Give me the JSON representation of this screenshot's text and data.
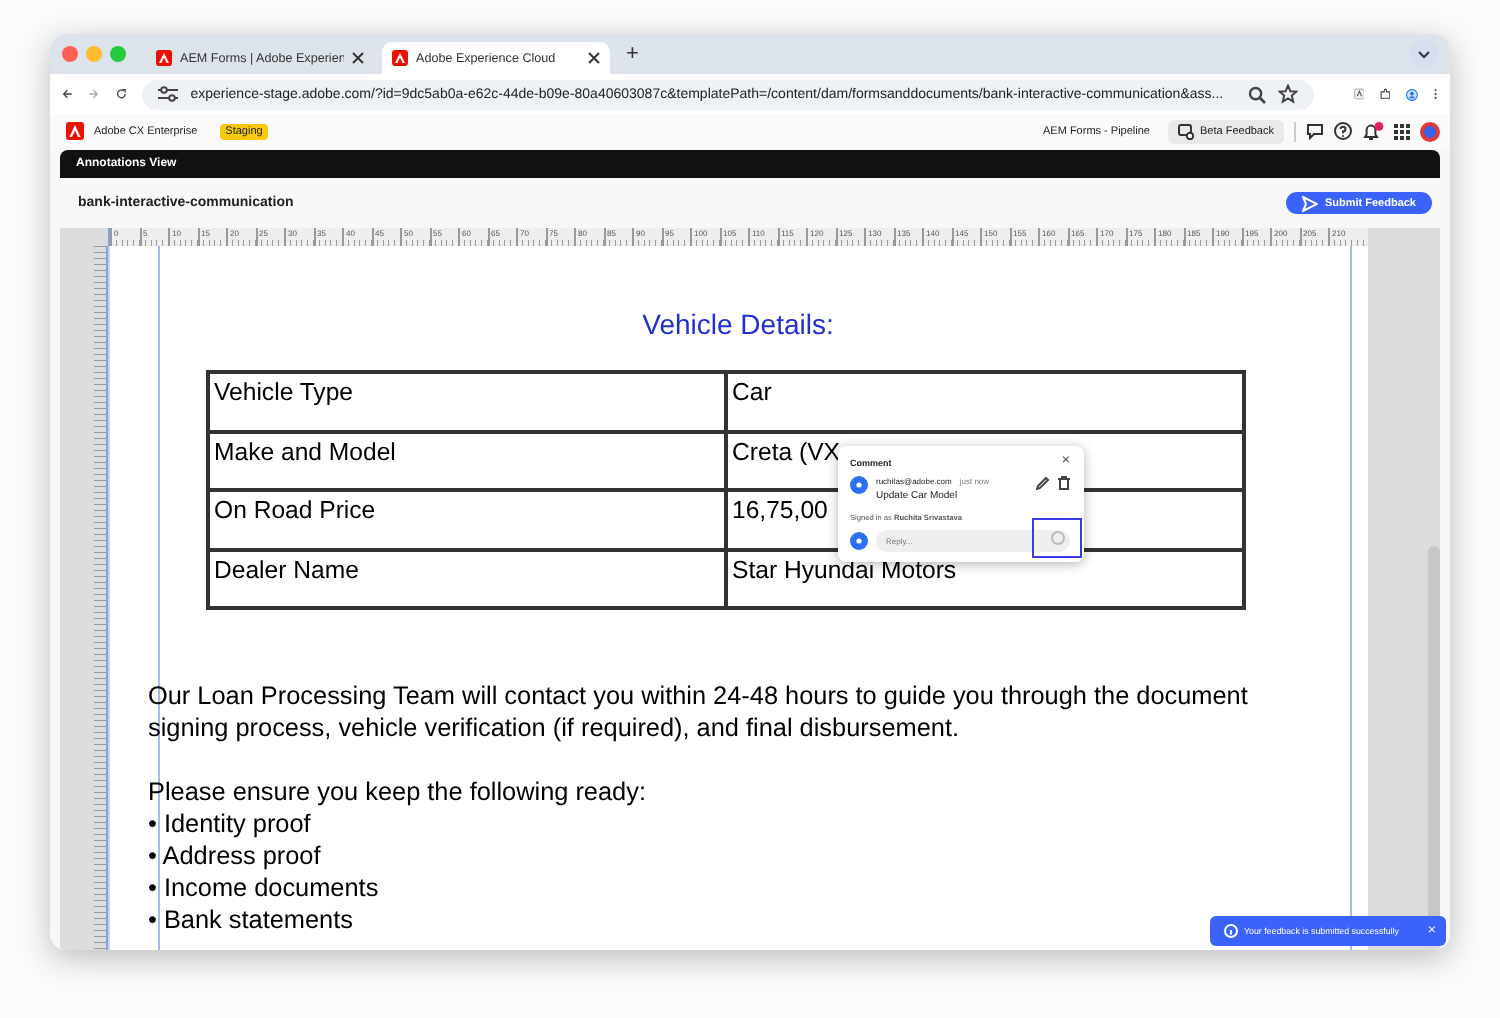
{
  "browser": {
    "tabs": [
      {
        "title": "AEM Forms | Adobe Experien",
        "selected": false
      },
      {
        "title": "Adobe Experience Cloud",
        "selected": true
      }
    ],
    "new_tab": "+",
    "address": "experience-stage.adobe.com/?id=9dc5ab0a-e62c-44de-b09e-80a40603087c&templatePath=/content/dam/formsanddocuments/bank-interactive-communication&ass..."
  },
  "app_header": {
    "brand": "Adobe CX Enterprise",
    "badge": "Staging",
    "workspace": "AEM Forms - Pipeline",
    "beta_button": "Beta Feedback"
  },
  "view_bar": {
    "title": "Annotations View"
  },
  "document_bar": {
    "title": "bank-interactive-communication",
    "submit_button": "Submit Feedback"
  },
  "ruler": {
    "labels": [
      "0",
      "5",
      "10",
      "15",
      "20",
      "25",
      "30",
      "35",
      "40",
      "45",
      "50",
      "55",
      "60",
      "65",
      "70",
      "75",
      "80",
      "85",
      "90",
      "95",
      "100",
      "105",
      "110",
      "115",
      "120",
      "125",
      "130",
      "135",
      "140",
      "145",
      "150",
      "155",
      "160",
      "165",
      "170",
      "175",
      "180",
      "185",
      "190",
      "195",
      "200",
      "205",
      "210"
    ]
  },
  "document": {
    "heading": "Vehicle Details:",
    "table": [
      [
        "Vehicle Type",
        "Car"
      ],
      [
        "Make and Model",
        "Creta (VX"
      ],
      [
        "On Road Price",
        "16,75,00"
      ],
      [
        "Dealer Name",
        "Star Hyundai Motors"
      ]
    ],
    "paragraph": "Our Loan Processing Team will contact you within 24-48 hours to guide you through the document signing process, vehicle verification (if required), and final disbursement.",
    "list_intro": "Please ensure you keep the following ready:",
    "list": [
      "• Identity proof",
      "• Address proof",
      "• Income documents",
      "• Bank statements"
    ]
  },
  "comment": {
    "title": "Comment",
    "close": "×",
    "author": "ruchitas@adobe.com",
    "time": "just now",
    "text": "Update Car Model",
    "signed_in": "Signed in as **Ruchita Srivastava**",
    "reply_placeholder": "Reply..."
  },
  "toast": {
    "message": "Your feedback is submitted successfully",
    "close": "×"
  }
}
